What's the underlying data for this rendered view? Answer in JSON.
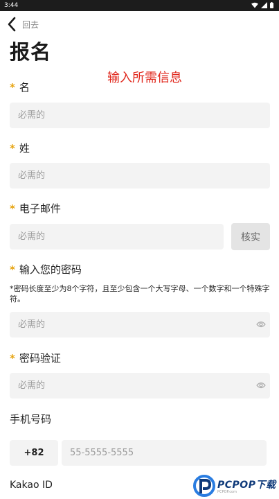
{
  "status_bar": {
    "time": "3:44"
  },
  "header": {
    "back_label": "回去",
    "title": "报名"
  },
  "annotation": "输入所需信息",
  "fields": {
    "first_name": {
      "label": "名",
      "placeholder": "必需的"
    },
    "last_name": {
      "label": "姓",
      "placeholder": "必需的"
    },
    "email": {
      "label": "电子邮件",
      "placeholder": "必需的",
      "verify_label": "核实"
    },
    "password": {
      "label": "输入您的密码",
      "hint": "*密码长度至少为8个字符，且至少包含一个大写字母、一个数字和一个特殊字符。",
      "placeholder": "必需的"
    },
    "password_confirm": {
      "label": "密码验证",
      "placeholder": "必需的"
    },
    "phone": {
      "label": "手机号码",
      "country_code": "+82",
      "placeholder": "55-5555-5555"
    },
    "kakao": {
      "label": "Kakao ID"
    }
  },
  "required_mark": "*",
  "watermark": {
    "brand": "PCPOP下载",
    "sub": "PCPOP.com"
  },
  "colors": {
    "accent_star": "#e6a20c",
    "annotation": "#e0261b",
    "field_bg": "#f3f3f3"
  }
}
